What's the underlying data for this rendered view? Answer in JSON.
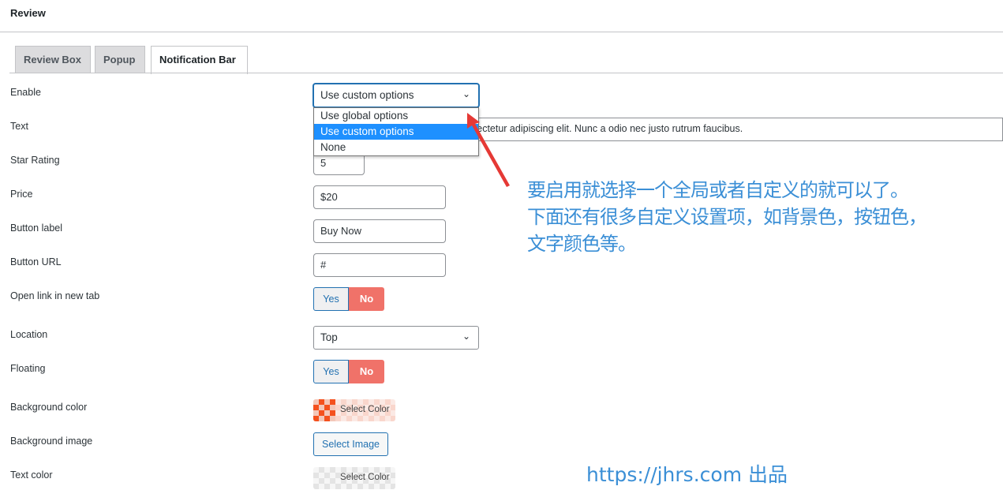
{
  "header": {
    "title": "Review"
  },
  "tabs": [
    {
      "label": "Review Box"
    },
    {
      "label": "Popup"
    },
    {
      "label": "Notification Bar",
      "active": true
    }
  ],
  "fields": {
    "enable": {
      "label": "Enable",
      "value": "Use custom options",
      "options": [
        "Use global options",
        "Use custom options",
        "None"
      ]
    },
    "text": {
      "label": "Text",
      "value_visible": "sectetur adipiscing elit. Nunc a odio nec justo rutrum faucibus."
    },
    "star_rating": {
      "label": "Star Rating",
      "value": "5"
    },
    "price": {
      "label": "Price",
      "value": "$20"
    },
    "button_label": {
      "label": "Button label",
      "value": "Buy Now"
    },
    "button_url": {
      "label": "Button URL",
      "value": "#"
    },
    "open_new_tab": {
      "label": "Open link in new tab",
      "yes": "Yes",
      "no": "No",
      "selected": "No"
    },
    "location": {
      "label": "Location",
      "value": "Top"
    },
    "floating": {
      "label": "Floating",
      "yes": "Yes",
      "no": "No",
      "selected": "No"
    },
    "background_color": {
      "label": "Background color",
      "button": "Select Color",
      "color": "#f4511e"
    },
    "background_image": {
      "label": "Background image",
      "button": "Select Image"
    },
    "text_color": {
      "label": "Text color",
      "button": "Select Color"
    }
  },
  "annotation": {
    "line1": "要启用就选择一个全局或者自定义的就可以了。",
    "line2": "下面还有很多自定义设置项，如背景色，按钮色，",
    "line3": "文字颜色等。",
    "credit": "https://jhrs.com 出品",
    "color": "#3b8fd6"
  }
}
